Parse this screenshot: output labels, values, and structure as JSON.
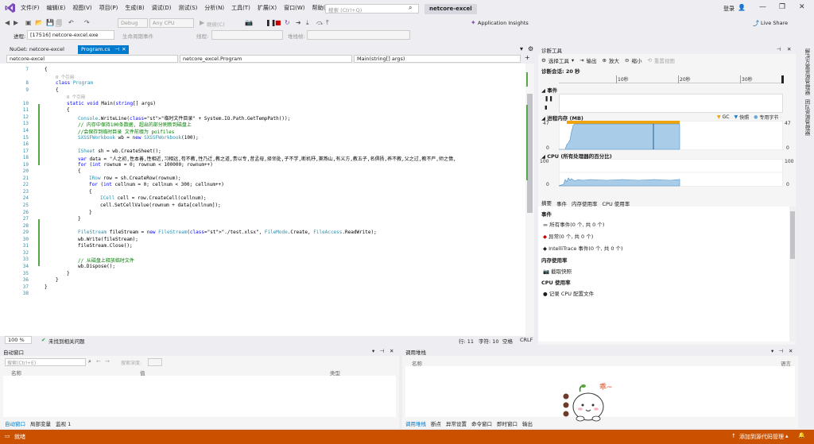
{
  "menubar": {
    "items": [
      "文件(F)",
      "编辑(E)",
      "视图(V)",
      "项目(P)",
      "生成(B)",
      "调试(D)",
      "测试(S)",
      "分析(N)",
      "工具(T)",
      "扩展(X)",
      "窗口(W)",
      "帮助(H)"
    ],
    "search_placeholder": "搜索 (Ctrl+Q)",
    "solution_name": "netcore-excel",
    "login": "登录",
    "live_share": "Live Share"
  },
  "toolbar": {
    "config": "Debug",
    "platform": "Any CPU",
    "continue": "继续(C)",
    "app_insights": "Application Insights"
  },
  "procbar": {
    "process_label": "进程:",
    "process_value": "[17516] netcore-excel.exe",
    "lifecycle": "生命周期事件",
    "thread_label": "线程:",
    "stack_label": "堆栈帧:"
  },
  "tabs": {
    "nuget": "NuGet: netcore-excel",
    "program": "Program.cs"
  },
  "nav": {
    "project": "netcore-excel",
    "class": "netcore_excel.Program",
    "method": "Main(string[] args)"
  },
  "editor": {
    "lines": [
      {
        "n": "7",
        "t": "{"
      },
      {
        "n": "",
        "t": "0 个引用"
      },
      {
        "n": "8",
        "t": "class Program"
      },
      {
        "n": "9",
        "t": "{"
      },
      {
        "n": "",
        "t": "0 个引用"
      },
      {
        "n": "10",
        "t": "static void Main(string[] args)"
      },
      {
        "n": "11",
        "t": "{"
      },
      {
        "n": "12",
        "t": "Console.WriteLine(\"临时文件目录\" + System.IO.Path.GetTempPath());"
      },
      {
        "n": "13",
        "t": "// 内存中保持100条数据, 超出的部分刷新到磁盘上"
      },
      {
        "n": "14",
        "t": "//会保存到临时目录 文件前缀为 poifiles"
      },
      {
        "n": "15",
        "t": "SXSSFWorkbook wb = new SXSSFWorkbook(100);"
      },
      {
        "n": "16",
        "t": ""
      },
      {
        "n": "17",
        "t": "ISheet sh = wb.CreateSheet();"
      },
      {
        "n": "18",
        "t": "var data = \"人之初,性本善,性相近,习相远,苟不教,性乃迁,教之道,贵以专,昔孟母,择邻处,子不学,断机杼,窦燕山,有义方,教五子,名俱扬,养不教,父之过,教不严,师之惰,"
      },
      {
        "n": "19",
        "t": "for (int rownum = 0; rownum < 100000; rownum++)"
      },
      {
        "n": "20",
        "t": "{"
      },
      {
        "n": "21",
        "t": "IRow row = sh.CreateRow(rownum);"
      },
      {
        "n": "22",
        "t": "for (int cellnum = 0; cellnum < 300; cellnum++)"
      },
      {
        "n": "23",
        "t": "{"
      },
      {
        "n": "24",
        "t": "ICell cell = row.CreateCell(cellnum);"
      },
      {
        "n": "25",
        "t": "cell.SetCellValue(rownum + data[cellnum]);"
      },
      {
        "n": "26",
        "t": "}"
      },
      {
        "n": "27",
        "t": "}"
      },
      {
        "n": "28",
        "t": ""
      },
      {
        "n": "29",
        "t": "FileStream fileStream = new FileStream(\"./test.xlsx\", FileMode.Create, FileAccess.ReadWrite);"
      },
      {
        "n": "30",
        "t": "wb.Write(fileStream);"
      },
      {
        "n": "31",
        "t": "fileStream.Close();"
      },
      {
        "n": "32",
        "t": ""
      },
      {
        "n": "33",
        "t": "// 从磁盘上释放临时文件"
      },
      {
        "n": "34",
        "t": "wb.Dispose();"
      },
      {
        "n": "35",
        "t": "}"
      },
      {
        "n": "36",
        "t": "}"
      },
      {
        "n": "37",
        "t": "}"
      },
      {
        "n": "38",
        "t": ""
      }
    ]
  },
  "editor_status": {
    "zoom": "100 %",
    "issues": "未找到相关问题",
    "line": "行: 11",
    "char": "字符: 10",
    "mode": "空格",
    "eol": "CRLF"
  },
  "diag": {
    "title": "诊断工具",
    "select_tool": "选择工具",
    "output": "输出",
    "zoom_in": "放大",
    "zoom_out": "缩小",
    "reset_view": "重置视图",
    "session": "诊断会话: 20 秒",
    "t10": "10秒",
    "t20": "20秒",
    "t30": "30秒",
    "events_label": "事件",
    "mem_label": "进程内存 (MB)",
    "gc": "GC",
    "snapshot": "快照",
    "private": "专用字节",
    "mem_max": "47",
    "mem_min": "0",
    "cpu_label": "CPU (所有处理器的百分比)",
    "cpu_max": "100",
    "cpu_min": "0",
    "tabs": [
      "摘要",
      "事件",
      "内存使用率",
      "CPU 使用率"
    ],
    "events_header": "事件",
    "all_events": "所有事件(0 个, 共 0 个)",
    "exceptions": "异常(0 个, 共 0 个)",
    "intellitrace": "IntelliTrace 事件(0 个, 共 0 个)",
    "mem_usage": "内存使用率",
    "take_snapshot": "截取快照",
    "cpu_usage": "CPU 使用率",
    "record_cpu": "记录 CPU 配置文件"
  },
  "right_sidebar": {
    "t1": "解决方案资源管理器",
    "t2": "团队资源管理器"
  },
  "autos": {
    "title": "自动窗口",
    "search_placeholder": "搜索(Ctrl+E)",
    "search_depth": "搜索深度:",
    "col_name": "名称",
    "col_value": "值",
    "col_type": "类型",
    "tabs": [
      "自动窗口",
      "局部变量",
      "监视 1"
    ]
  },
  "callstack": {
    "title": "调用堆栈",
    "col_name": "名称",
    "col_lang": "语言",
    "tabs": [
      "调用堆栈",
      "断点",
      "异常设置",
      "命令窗口",
      "即时窗口",
      "输出"
    ]
  },
  "sticker": {
    "text": "乖~"
  },
  "statusbar": {
    "ready": "就绪",
    "source_control": "添加到源代码管理"
  },
  "colors": {
    "statusbar": "#ca5100",
    "memory_fill": "#a9cde8",
    "cpu_fill": "#a9cde8",
    "gc_bar": "#f0a30a"
  }
}
